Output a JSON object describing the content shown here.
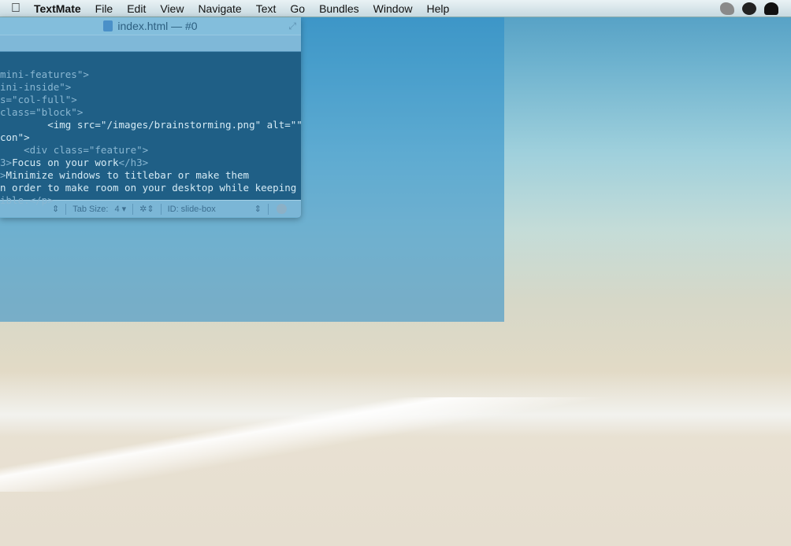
{
  "menubar": {
    "app": "TextMate",
    "items": [
      "File",
      "Edit",
      "View",
      "Navigate",
      "Text",
      "Go",
      "Bundles",
      "Window",
      "Help"
    ],
    "tray_icons": [
      "growl-icon",
      "checkmark-icon",
      "bowler-hat-icon"
    ]
  },
  "window": {
    "title": "index.html — #0",
    "lines": [
      [
        [
          "t",
          "mini-features\">"
        ]
      ],
      [
        [
          "t",
          "ini-inside\">"
        ]
      ],
      [
        [
          "t",
          "s=\"col-full\">"
        ]
      ],
      [
        [
          "t",
          "class=\"block\">"
        ]
      ],
      [
        [
          "c",
          "        <img src=\"/images/brainstorming.png\" alt=\"\""
        ]
      ],
      [
        [
          "c",
          "con\">"
        ]
      ],
      [
        [
          "t",
          "    <div class=\"feature\">"
        ]
      ],
      [
        [
          "t",
          "3>"
        ],
        [
          "c",
          "Focus on your work"
        ],
        [
          "t",
          "</h3>"
        ]
      ],
      [
        [
          "t",
          ">"
        ],
        [
          "c",
          "Minimize windows to titlebar or make them"
        ]
      ],
      [
        [
          "c",
          "n order to make room on your desktop while keeping"
        ]
      ],
      [
        [
          "t",
          "ible.</p>"
        ]
      ]
    ],
    "status": {
      "tab_size_label": "Tab Size:",
      "tab_size": "4",
      "symbol": "ID: slide-box"
    }
  },
  "colors": {
    "overlay": "#288cc8",
    "editor_bg": "#1f5f86"
  }
}
